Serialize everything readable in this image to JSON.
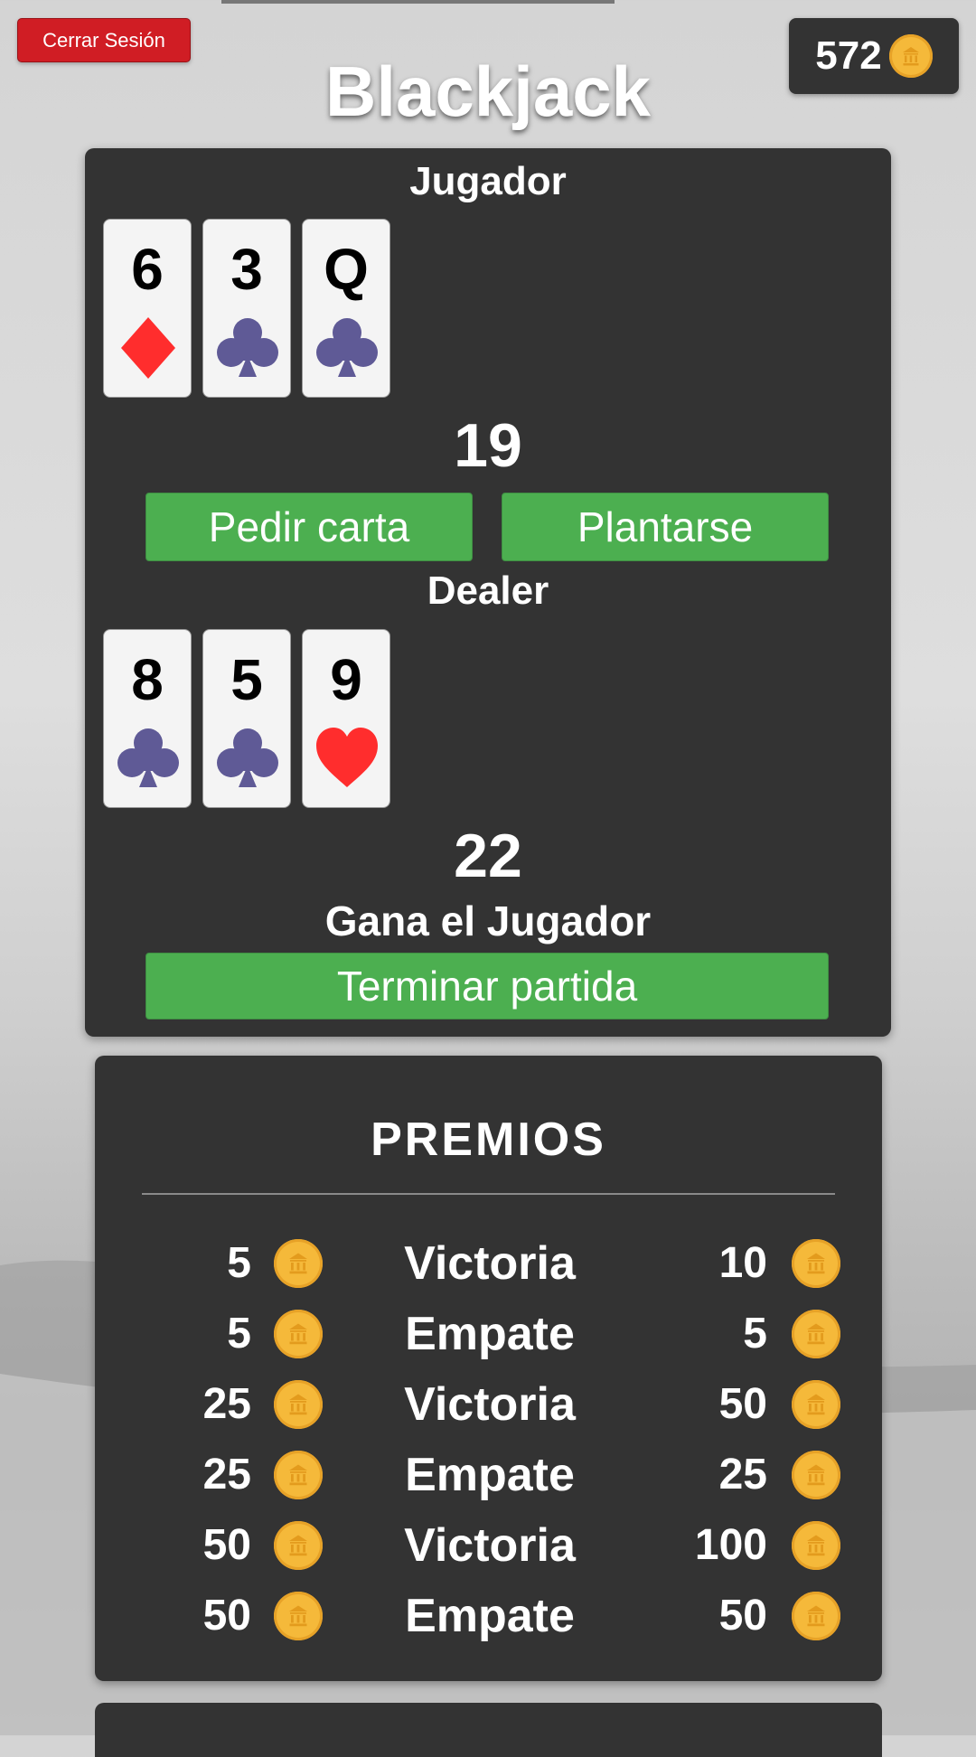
{
  "header": {
    "logout_label": "Cerrar Sesión",
    "title": "Blackjack",
    "balance": "572",
    "coin_icon": "coin-icon"
  },
  "player": {
    "label": "Jugador",
    "cards": [
      {
        "rank": "6",
        "suit": "diamond"
      },
      {
        "rank": "3",
        "suit": "club"
      },
      {
        "rank": "Q",
        "suit": "club"
      }
    ],
    "score": "19"
  },
  "actions": {
    "hit_label": "Pedir carta",
    "stand_label": "Plantarse"
  },
  "dealer": {
    "label": "Dealer",
    "cards": [
      {
        "rank": "8",
        "suit": "club"
      },
      {
        "rank": "5",
        "suit": "club"
      },
      {
        "rank": "9",
        "suit": "heart"
      }
    ],
    "score": "22"
  },
  "result_text": "Gana el Jugador",
  "end_button_label": "Terminar partida",
  "prizes": {
    "title": "PREMIOS",
    "rows": [
      {
        "bet": "5",
        "type": "Victoria",
        "win": "10"
      },
      {
        "bet": "5",
        "type": "Empate",
        "win": "5"
      },
      {
        "bet": "25",
        "type": "Victoria",
        "win": "50"
      },
      {
        "bet": "25",
        "type": "Empate",
        "win": "25"
      },
      {
        "bet": "50",
        "type": "Victoria",
        "win": "100"
      },
      {
        "bet": "50",
        "type": "Empate",
        "win": "50"
      }
    ]
  },
  "colors": {
    "panel": "#333333",
    "accent_green": "#4caf50",
    "logout_red": "#d01d24",
    "coin_gold": "#f5b93a",
    "suit_red": "#ff2d2d",
    "suit_purple": "#5f5a96"
  }
}
